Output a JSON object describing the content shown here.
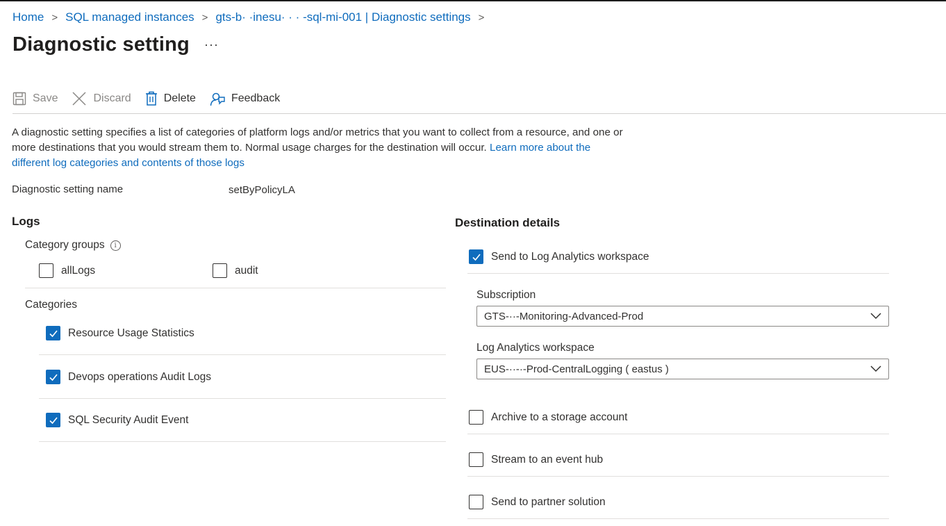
{
  "breadcrumb": {
    "items": [
      "Home",
      "SQL managed instances",
      "gts-b· ·inesu·  ·  ·  -sql-mi-001 | Diagnostic settings"
    ]
  },
  "page": {
    "title": "Diagnostic setting",
    "more": "···"
  },
  "toolbar": {
    "save": "Save",
    "discard": "Discard",
    "delete": "Delete",
    "feedback": "Feedback"
  },
  "description": {
    "text": "A diagnostic setting specifies a list of categories of platform logs and/or metrics that you want to collect from a resource, and one or more destinations that you would stream them to. Normal usage charges for the destination will occur. ",
    "link": "Learn more about the different log categories and contents of those logs"
  },
  "setting_name": {
    "label": "Diagnostic setting name",
    "value": "setByPolicyLA"
  },
  "logs": {
    "title": "Logs",
    "category_groups_label": "Category groups",
    "category_groups": [
      {
        "label": "allLogs",
        "checked": false
      },
      {
        "label": "audit",
        "checked": false
      }
    ],
    "categories_label": "Categories",
    "categories": [
      {
        "label": "Resource Usage Statistics",
        "checked": true
      },
      {
        "label": "Devops operations Audit Logs",
        "checked": true
      },
      {
        "label": "SQL Security Audit Event",
        "checked": true
      }
    ]
  },
  "destination": {
    "title": "Destination details",
    "log_analytics": {
      "label": "Send to Log Analytics workspace",
      "checked": true
    },
    "subscription_label": "Subscription",
    "subscription_value": "GTS-··-Monitoring-Advanced-Prod",
    "workspace_label": "Log Analytics workspace",
    "workspace_value": "EUS-··-·-Prod-CentralLogging ( eastus )",
    "options": [
      {
        "label": "Archive to a storage account",
        "checked": false
      },
      {
        "label": "Stream to an event hub",
        "checked": false
      },
      {
        "label": "Send to partner solution",
        "checked": false
      }
    ]
  },
  "colors": {
    "accent": "#0f6cbd",
    "text": "#323130",
    "disabled": "#8a8886",
    "divider": "#e1dfdd"
  }
}
